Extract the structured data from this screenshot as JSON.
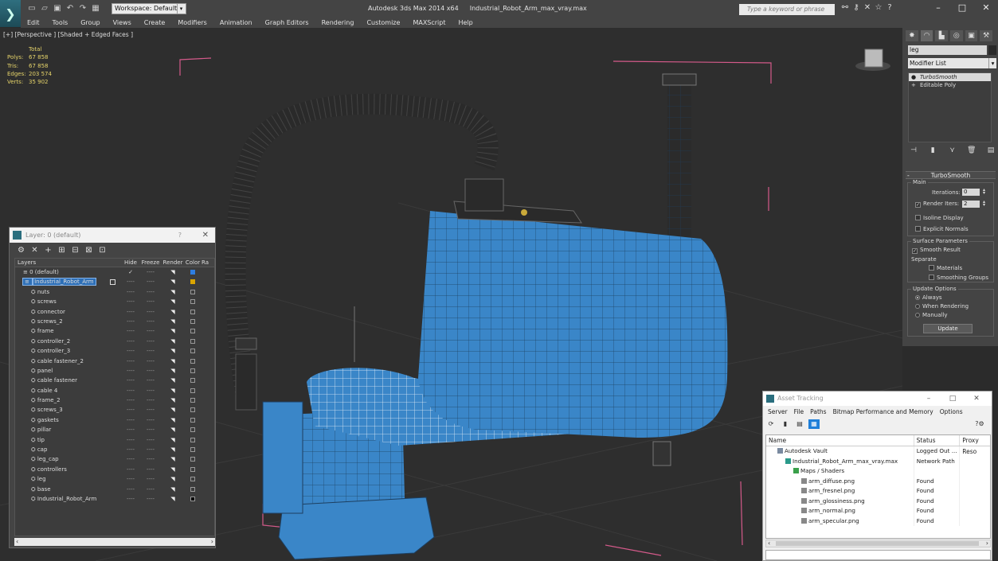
{
  "window": {
    "app_title": "Autodesk 3ds Max  2014 x64",
    "file_title": "Industrial_Robot_Arm_max_vray.max",
    "workspace_label": "Workspace: Default",
    "search_placeholder": "Type a keyword or phrase"
  },
  "menu": [
    "Edit",
    "Tools",
    "Group",
    "Views",
    "Create",
    "Modifiers",
    "Animation",
    "Graph Editors",
    "Rendering",
    "Customize",
    "MAXScript",
    "Help"
  ],
  "viewport": {
    "label": "[+] [Perspective ] [Shaded + Edged Faces ]",
    "stats_header": "Total",
    "stats": [
      {
        "k": "Polys:",
        "v": "67 858"
      },
      {
        "k": "Tris:",
        "v": "67 858"
      },
      {
        "k": "Edges:",
        "v": "203 574"
      },
      {
        "k": "Verts:",
        "v": "35 902"
      }
    ]
  },
  "command_panel": {
    "object_name": "leg",
    "modifier_list": "Modifier List",
    "stack": [
      "TurboSmooth",
      "Editable Poly"
    ],
    "rollout_title": "TurboSmooth",
    "main_group": "Main",
    "iterations_label": "Iterations:",
    "iterations_value": "0",
    "render_iters_label": "Render Iters:",
    "render_iters_value": "2",
    "isoline_label": "Isoline Display",
    "explicit_normals_label": "Explicit Normals",
    "surface_group": "Surface Parameters",
    "smooth_result_label": "Smooth Result",
    "separate_label": "Separate",
    "materials_label": "Materials",
    "smoothing_groups_label": "Smoothing Groups",
    "update_group": "Update Options",
    "always_label": "Always",
    "when_rendering_label": "When Rendering",
    "manually_label": "Manually",
    "update_button": "Update"
  },
  "layers_panel": {
    "title": "Layer: 0 (default)",
    "help": "?",
    "columns": [
      "Layers",
      "Hide",
      "Freeze",
      "Render",
      "Color",
      "Ra"
    ],
    "rows": [
      {
        "name": "0 (default)",
        "level": 0,
        "color": "#2e7de0",
        "check": "✓"
      },
      {
        "name": "Industrial_Robot_Arm",
        "level": 0,
        "color": "#d9a400",
        "selected": true
      },
      {
        "name": "nuts",
        "level": 1
      },
      {
        "name": "screws",
        "level": 1
      },
      {
        "name": "connector",
        "level": 1
      },
      {
        "name": "screws_2",
        "level": 1
      },
      {
        "name": "frame",
        "level": 1
      },
      {
        "name": "controller_2",
        "level": 1
      },
      {
        "name": "controller_3",
        "level": 1
      },
      {
        "name": "cable fastener_2",
        "level": 1
      },
      {
        "name": "panel",
        "level": 1
      },
      {
        "name": "cable fastener",
        "level": 1
      },
      {
        "name": "cable 4",
        "level": 1
      },
      {
        "name": "frame_2",
        "level": 1
      },
      {
        "name": "screws_3",
        "level": 1
      },
      {
        "name": "gaskets",
        "level": 1
      },
      {
        "name": "pillar",
        "level": 1
      },
      {
        "name": "tip",
        "level": 1
      },
      {
        "name": "cap",
        "level": 1
      },
      {
        "name": "leg_cap",
        "level": 1
      },
      {
        "name": "controllers",
        "level": 1
      },
      {
        "name": "leg",
        "level": 1
      },
      {
        "name": "base",
        "level": 1
      },
      {
        "name": "Industrial_Robot_Arm",
        "level": 1,
        "color": "#000000"
      }
    ]
  },
  "asset_tracking": {
    "title": "Asset Tracking",
    "menu": [
      "Server",
      "File",
      "Paths",
      "Bitmap Performance and Memory",
      "Options"
    ],
    "columns": [
      "Name",
      "Status",
      "Proxy Reso"
    ],
    "rows": [
      {
        "name": "Autodesk Vault",
        "status": "Logged Out ...",
        "indent": 1
      },
      {
        "name": "Industrial_Robot_Arm_max_vray.max",
        "status": "Network Path",
        "indent": 2
      },
      {
        "name": "Maps / Shaders",
        "status": "",
        "indent": 3
      },
      {
        "name": "arm_diffuse.png",
        "status": "Found",
        "indent": 4
      },
      {
        "name": "arm_fresnel.png",
        "status": "Found",
        "indent": 4
      },
      {
        "name": "arm_glossiness.png",
        "status": "Found",
        "indent": 4
      },
      {
        "name": "arm_normal.png",
        "status": "Found",
        "indent": 4
      },
      {
        "name": "arm_specular.png",
        "status": "Found",
        "indent": 4
      }
    ]
  },
  "colors": {
    "robot_blue": "#3a86c8",
    "selection_blue": "#2d6fb7",
    "cable_dark": "#2a2a2a",
    "stats_yellow": "#e6d46a",
    "bbox_pink": "#d45a8a"
  }
}
